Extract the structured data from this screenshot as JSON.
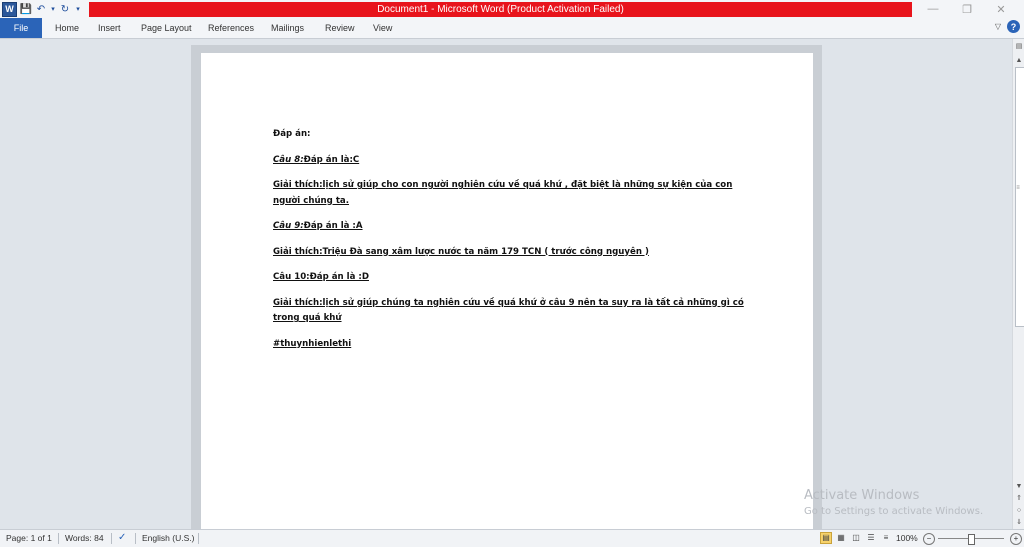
{
  "window": {
    "title": "Document1 - Microsoft Word (Product Activation Failed)",
    "word_logo": "W",
    "qat_icons": [
      "word-icon",
      "save-icon",
      "undo-icon",
      "redo-icon",
      "customize-icon"
    ],
    "controls": [
      "minimize-icon",
      "restore-icon",
      "close-icon"
    ],
    "accent": "#e8141c"
  },
  "ribbon": {
    "file_tab": "File",
    "tabs": [
      "Home",
      "Insert",
      "Page Layout",
      "References",
      "Mailings",
      "Review",
      "View"
    ],
    "help": "?"
  },
  "document": {
    "lines": [
      {
        "parts": [
          {
            "text": "Đáp án:",
            "italic": false,
            "underline": false
          }
        ]
      },
      {
        "parts": [
          {
            "text": "Câu 8:",
            "italic": true,
            "underline": true
          },
          {
            "text": "Đáp án là:C",
            "italic": false,
            "underline": true
          }
        ]
      },
      {
        "parts": [
          {
            "text": "Giải thích:lịch sử giúp cho con người nghiên cứu về quá khứ , đặt biệt là những sự kiện của con người chúng ta.",
            "italic": false,
            "underline": true
          }
        ]
      },
      {
        "parts": [
          {
            "text": "Câu 9:",
            "italic": true,
            "underline": true
          },
          {
            "text": "Đáp án là :A",
            "italic": false,
            "underline": true
          }
        ]
      },
      {
        "parts": [
          {
            "text": "Giải thích:Triệu Đà sang xâm lược nước ta năm 179 TCN ( trước công nguyên )",
            "italic": false,
            "underline": true
          }
        ]
      },
      {
        "parts": [
          {
            "text": "Câu 10:Đáp án là :D",
            "italic": false,
            "underline": true
          }
        ]
      },
      {
        "parts": [
          {
            "text": "Giải thích:lịch sử giúp chúng ta nghiên cứu về quá khứ ở câu 9 nên ta suy ra là tất cả những gì có trong quá khứ",
            "italic": false,
            "underline": true
          }
        ]
      },
      {
        "parts": [
          {
            "text": "#thuynhienlethi",
            "italic": false,
            "underline": true
          }
        ]
      }
    ]
  },
  "watermark": {
    "line1": "Activate Windows",
    "line2": "Go to Settings to activate Windows."
  },
  "status": {
    "page": "Page: 1 of 1",
    "words": "Words: 84",
    "language": "English (U.S.)",
    "zoom": "100%",
    "zoom_level": 1.0
  }
}
